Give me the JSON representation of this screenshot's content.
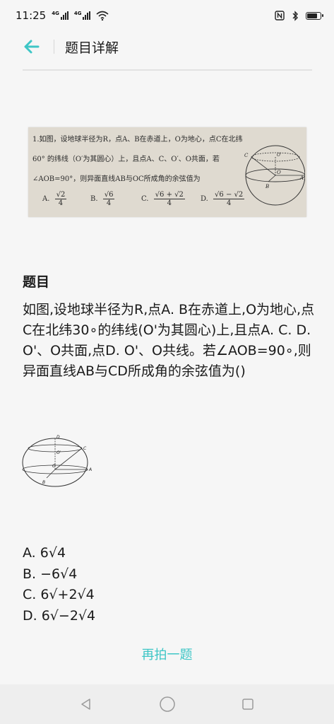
{
  "status_bar": {
    "time": "11:25",
    "signal1_label": "4G",
    "signal2_label": "4G",
    "battery_level": 0.85
  },
  "header": {
    "title": "题目详解"
  },
  "photo": {
    "lines": [
      "1.如图，设地球半径为R，点A、B在赤道上，O为地心，点C在北纬",
      "60° 的纬线（O′为其圆心）上，且点A、C、O′、O共面，若",
      "∠AOB=90°，则异面直线AB与OC所成角的余弦值为"
    ],
    "choices": [
      {
        "letter": "A.",
        "num": "√2",
        "den": "4"
      },
      {
        "letter": "B.",
        "num": "√6",
        "den": "4"
      },
      {
        "letter": "C.",
        "num": "√6 + √2",
        "den": "4"
      },
      {
        "letter": "D.",
        "num": "√6 − √2",
        "den": "4"
      }
    ],
    "globe_labels": {
      "c": "C",
      "o_prime": "O′",
      "o": "O",
      "a": "A",
      "b": "B"
    }
  },
  "question": {
    "label": "题目",
    "text": "如图,设地球半径为R,点A. B在赤道上,O为地心,点C在北纬30∘的纬线(O'为其圆心)上,且点A. C. D. O'、O共面,点D. O'、O共线。若∠AOB=90∘,则异面直线AB与CD所成角的余弦值为()"
  },
  "diagram_labels": {
    "d": "D",
    "c": "C",
    "o_prime": "O′",
    "o": "O",
    "a": "A",
    "b": "B"
  },
  "options": [
    "A. 6√4",
    "B. −6√4",
    "C. 6√+2√4",
    "D. 6√−2√4"
  ],
  "actions": {
    "retake_label": "再拍一题"
  },
  "colors": {
    "accent": "#3ec6c6",
    "background": "#f6f6f6"
  }
}
